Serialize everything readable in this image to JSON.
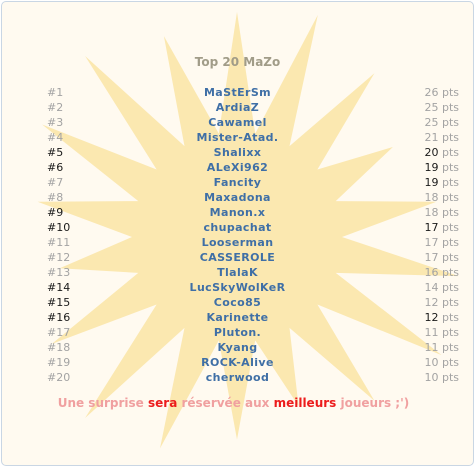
{
  "title": "Top 20 MaZo",
  "colors": {
    "background": "#fffaf0",
    "burst": "#fae4a4",
    "name": "#3f6fa6",
    "rank_normal": "#a3a3a3",
    "rank_highlight": "#1a1a1a",
    "footer_pale": "#f0a0a0",
    "footer_strong": "#ec1c1c"
  },
  "rows": [
    {
      "rank": "#1",
      "name": "MaStErSm",
      "points": "26",
      "unit": "pts",
      "rank_hl": false,
      "pts_hl": false
    },
    {
      "rank": "#2",
      "name": "ArdiaZ",
      "points": "25",
      "unit": "pts",
      "rank_hl": false,
      "pts_hl": false
    },
    {
      "rank": "#3",
      "name": "Cawamel",
      "points": "25",
      "unit": "pts",
      "rank_hl": false,
      "pts_hl": false
    },
    {
      "rank": "#4",
      "name": "Mister-Atad.",
      "points": "21",
      "unit": "pts",
      "rank_hl": false,
      "pts_hl": false
    },
    {
      "rank": "#5",
      "name": "Shalixx",
      "points": "20",
      "unit": "pts",
      "rank_hl": true,
      "pts_hl": true
    },
    {
      "rank": "#6",
      "name": "ALeXi962",
      "points": "19",
      "unit": "pts",
      "rank_hl": true,
      "pts_hl": true
    },
    {
      "rank": "#7",
      "name": "Fancity",
      "points": "19",
      "unit": "pts",
      "rank_hl": false,
      "pts_hl": true
    },
    {
      "rank": "#8",
      "name": "Maxadona",
      "points": "18",
      "unit": "pts",
      "rank_hl": false,
      "pts_hl": false
    },
    {
      "rank": "#9",
      "name": "Manon.x",
      "points": "18",
      "unit": "pts",
      "rank_hl": true,
      "pts_hl": false
    },
    {
      "rank": "#10",
      "name": "chupachat",
      "points": "17",
      "unit": "pts",
      "rank_hl": true,
      "pts_hl": true
    },
    {
      "rank": "#11",
      "name": "Looserman",
      "points": "17",
      "unit": "pts",
      "rank_hl": false,
      "pts_hl": false
    },
    {
      "rank": "#12",
      "name": "CASSEROLE",
      "points": "17",
      "unit": "pts",
      "rank_hl": false,
      "pts_hl": false
    },
    {
      "rank": "#13",
      "name": "TlalaK",
      "points": "16",
      "unit": "pts",
      "rank_hl": false,
      "pts_hl": false
    },
    {
      "rank": "#14",
      "name": "LucSkyWolKeR",
      "points": "14",
      "unit": "pts",
      "rank_hl": true,
      "pts_hl": false
    },
    {
      "rank": "#15",
      "name": "Coco85",
      "points": "12",
      "unit": "pts",
      "rank_hl": true,
      "pts_hl": false
    },
    {
      "rank": "#16",
      "name": "Karinette",
      "points": "12",
      "unit": "pts",
      "rank_hl": true,
      "pts_hl": true
    },
    {
      "rank": "#17",
      "name": "Pluton.",
      "points": "11",
      "unit": "pts",
      "rank_hl": false,
      "pts_hl": false
    },
    {
      "rank": "#18",
      "name": "Kyang",
      "points": "11",
      "unit": "pts",
      "rank_hl": false,
      "pts_hl": false
    },
    {
      "rank": "#19",
      "name": "ROCK-Alive",
      "points": "10",
      "unit": "pts",
      "rank_hl": false,
      "pts_hl": false
    },
    {
      "rank": "#20",
      "name": "cherwood",
      "points": "10",
      "unit": "pts",
      "rank_hl": false,
      "pts_hl": false
    }
  ],
  "footer": {
    "part1": "Une surprise ",
    "part2": "sera",
    "part3": " réservée aux ",
    "part4": "meilleurs",
    "part5": " joueurs ;')"
  }
}
